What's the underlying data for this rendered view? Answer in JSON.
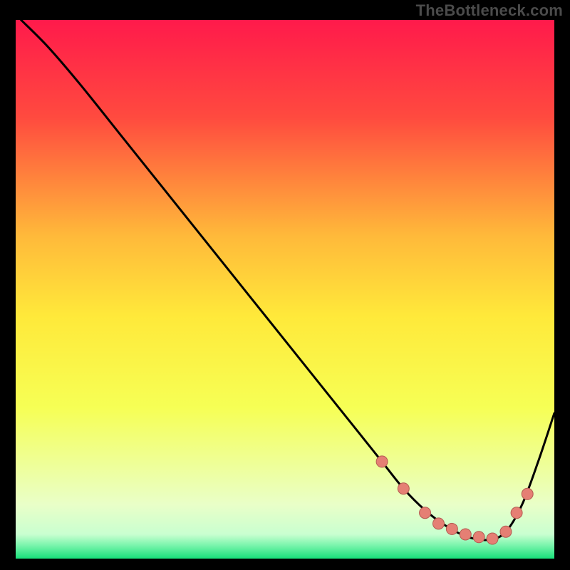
{
  "watermark": "TheBottleneck.com",
  "colors": {
    "black": "#000000",
    "curve": "#000000",
    "marker_fill": "#e57f74",
    "marker_stroke": "#b45a50",
    "grad_top": "#ff1a4b",
    "grad_mid_upper": "#ff7a3a",
    "grad_mid": "#ffd83a",
    "grad_mid_lower": "#f6ff4a",
    "grad_pale": "#eaffda",
    "grad_green": "#18e07a"
  },
  "chart_data": {
    "type": "line",
    "title": "",
    "xlabel": "",
    "ylabel": "",
    "xlim": [
      0,
      100
    ],
    "ylim": [
      0,
      100
    ],
    "grid": false,
    "legend": false,
    "background_gradient": [
      {
        "offset": 0.0,
        "color": "#ff1a4b"
      },
      {
        "offset": 0.18,
        "color": "#ff4a3f"
      },
      {
        "offset": 0.4,
        "color": "#ffb93a"
      },
      {
        "offset": 0.55,
        "color": "#ffe93a"
      },
      {
        "offset": 0.72,
        "color": "#f6ff55"
      },
      {
        "offset": 0.9,
        "color": "#e9ffc8"
      },
      {
        "offset": 0.955,
        "color": "#c9ffd0"
      },
      {
        "offset": 0.975,
        "color": "#7cf5ad"
      },
      {
        "offset": 1.0,
        "color": "#18e07a"
      }
    ],
    "series": [
      {
        "name": "bottleneck-curve",
        "x": [
          1,
          6,
          12,
          20,
          30,
          40,
          50,
          58,
          64,
          68,
          72,
          76,
          80,
          84,
          88,
          91,
          94,
          97,
          100
        ],
        "y": [
          100,
          95,
          88,
          78,
          65.5,
          53,
          40.5,
          30.5,
          23,
          18,
          13,
          9,
          6,
          4,
          3.5,
          5,
          10,
          18,
          27
        ]
      }
    ],
    "markers": {
      "name": "highlight-dots",
      "x": [
        68,
        72,
        76,
        78.5,
        81,
        83.5,
        86,
        88.5,
        91,
        93,
        95
      ],
      "y": [
        18,
        13,
        8.5,
        6.5,
        5.5,
        4.5,
        4,
        3.7,
        5,
        8.5,
        12
      ]
    }
  }
}
